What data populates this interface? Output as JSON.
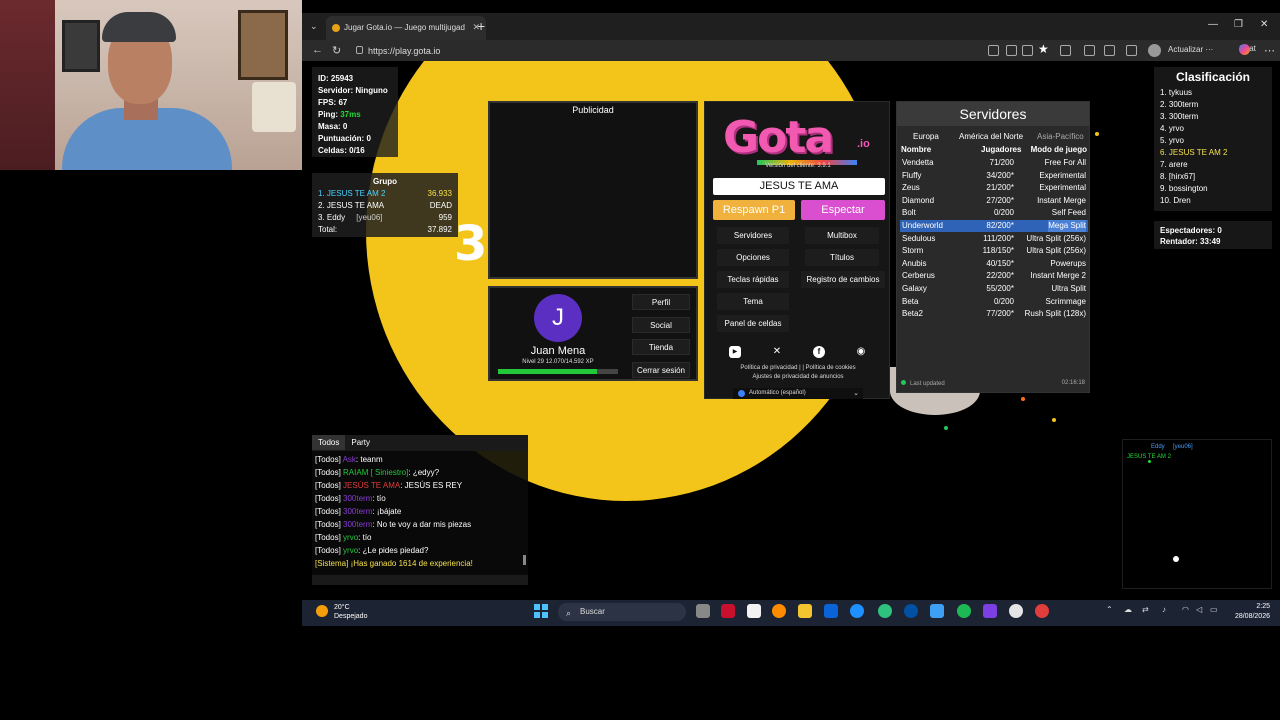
{
  "browser": {
    "tab_title": "Jugar Gota.io — Juego multijugad",
    "url": "https://play.gota.io",
    "update_label": "Actualizar ···",
    "chat_label": "Chat"
  },
  "stats": {
    "id": "ID: 25943",
    "server": "Servidor: Ninguno",
    "fps": "FPS: 67",
    "ping_label": "Ping: ",
    "ping_value": "37ms",
    "mass": "Masa: 0",
    "score": "Puntuación: 0",
    "cells": "Celdas: 0/16"
  },
  "group": {
    "title": "Grupo",
    "rows": [
      {
        "name": "1. JESUS TE AM 2",
        "sub": "",
        "value": "36.933"
      },
      {
        "name": "2. JESUS TE AMA",
        "sub": "",
        "value": "DEAD"
      },
      {
        "name": "3. Eddy",
        "sub": "[yeu06]",
        "value": "959"
      }
    ],
    "total_label": "Total:",
    "total_value": "37.892"
  },
  "game": {
    "blob_number": "3"
  },
  "ad": {
    "label": "Publicidad"
  },
  "profile": {
    "initial": "J",
    "name": "Juan Mena",
    "level": "Nivel 29 12.070/14.592 XP",
    "xp_fraction": 0.827,
    "buttons": [
      "Perfil",
      "Social",
      "Tienda",
      "Cerrar sesión"
    ]
  },
  "main": {
    "logo": "Gota",
    "logo_suffix": ".io",
    "version": "Versión del cliente: 3.9.1",
    "nickname": "JESUS TE AMA",
    "respawn": "Respawn P1",
    "spectate": "Espectar",
    "left_buttons": [
      "Servidores",
      "Opciones",
      "Teclas rápidas",
      "Tema",
      "Panel de celdas"
    ],
    "right_buttons": [
      "Multibox",
      "Títulos",
      "Registro de cambios"
    ],
    "legal1": "Política de privacidad | | Política de cookies",
    "legal2": "Ajustes de privacidad de anuncios",
    "language": "Automático (español)"
  },
  "servers": {
    "title": "Servidores",
    "regions": [
      "Europa",
      "América del Norte",
      "Asia-Pacífico"
    ],
    "headers": [
      "Nombre",
      "Jugadores",
      "Modo de juego"
    ],
    "rows": [
      {
        "name": "Vendetta",
        "players": "71/200",
        "mode": "Free For All"
      },
      {
        "name": "Fluffy",
        "players": "34/200*",
        "mode": "Experimental"
      },
      {
        "name": "Zeus",
        "players": "21/200*",
        "mode": "Experimental"
      },
      {
        "name": "Diamond",
        "players": "27/200*",
        "mode": "Instant Merge"
      },
      {
        "name": "Bolt",
        "players": "0/200",
        "mode": "Self Feed"
      },
      {
        "name": "Underworld",
        "players": "82/200*",
        "mode": "Mega Split"
      },
      {
        "name": "Sedulous",
        "players": "111/200*",
        "mode": "Ultra Split (256x)"
      },
      {
        "name": "Storm",
        "players": "118/150*",
        "mode": "Ultra Split (256x)"
      },
      {
        "name": "Anubis",
        "players": "40/150*",
        "mode": "Powerups"
      },
      {
        "name": "Cerberus",
        "players": "22/200*",
        "mode": "Instant Merge 2"
      },
      {
        "name": "Galaxy",
        "players": "55/200*",
        "mode": "Ultra Split"
      },
      {
        "name": "Beta",
        "players": "0/200",
        "mode": "Scrimmage"
      },
      {
        "name": "Beta2",
        "players": "77/200*",
        "mode": "Rush Split (128x)"
      }
    ],
    "selected_index": 5,
    "footer_label": "Last updated",
    "footer_time": "02:16:18"
  },
  "leaderboard": {
    "title": "Clasificación",
    "entries": [
      "1. tykuus",
      "2. 300term",
      "3. 300term",
      "4. yrvo",
      "5. yrvo",
      "6. JESUS TE AM 2",
      "7. arere",
      "8. [hirx67]",
      "9. bossington",
      "10. Dren"
    ],
    "me_index": 5
  },
  "spectators": {
    "line1": "Espectadores: 0",
    "line2": "Rentador: 33:49"
  },
  "chat": {
    "tabs": [
      "Todos",
      "Party"
    ],
    "messages": [
      {
        "tag": "[Todos]",
        "name": "Ask",
        "name_color": "#8a3ad6",
        "text": ": teanm"
      },
      {
        "tag": "[Todos]",
        "name": "RAIAM [ Siniestro]",
        "name_color": "#22c73a",
        "text": ": ¿edyy?"
      },
      {
        "tag": "[Todos]",
        "name": "JESÚS TE AMA",
        "name_color": "#e03a3a",
        "text": ": JESÚS ES REY"
      },
      {
        "tag": "[Todos]",
        "name": "300term",
        "name_color": "#8a3ad6",
        "text": ": tío"
      },
      {
        "tag": "[Todos]",
        "name": "300term",
        "name_color": "#8a3ad6",
        "text": ": ¡bájate"
      },
      {
        "tag": "[Todos]",
        "name": "300term",
        "name_color": "#8a3ad6",
        "text": ": No te voy a dar mis piezas"
      },
      {
        "tag": "[Todos]",
        "name": "yrvo",
        "name_color": "#22c73a",
        "text": ": tío"
      },
      {
        "tag": "[Todos]",
        "name": "yrvo",
        "name_color": "#22c73a",
        "text": ": ¿Le pides piedad?"
      }
    ],
    "system": "[Sistema] ¡Has ganado 1614 de experiencia!"
  },
  "minimap": {
    "label1": "Eddy",
    "label2": "[yeu06]",
    "label3": "JESUS TE AM 2"
  },
  "taskbar": {
    "temp": "20°C",
    "weather": "Despejado",
    "search": "Buscar",
    "time": "2:25",
    "date": "28/08/2026"
  }
}
